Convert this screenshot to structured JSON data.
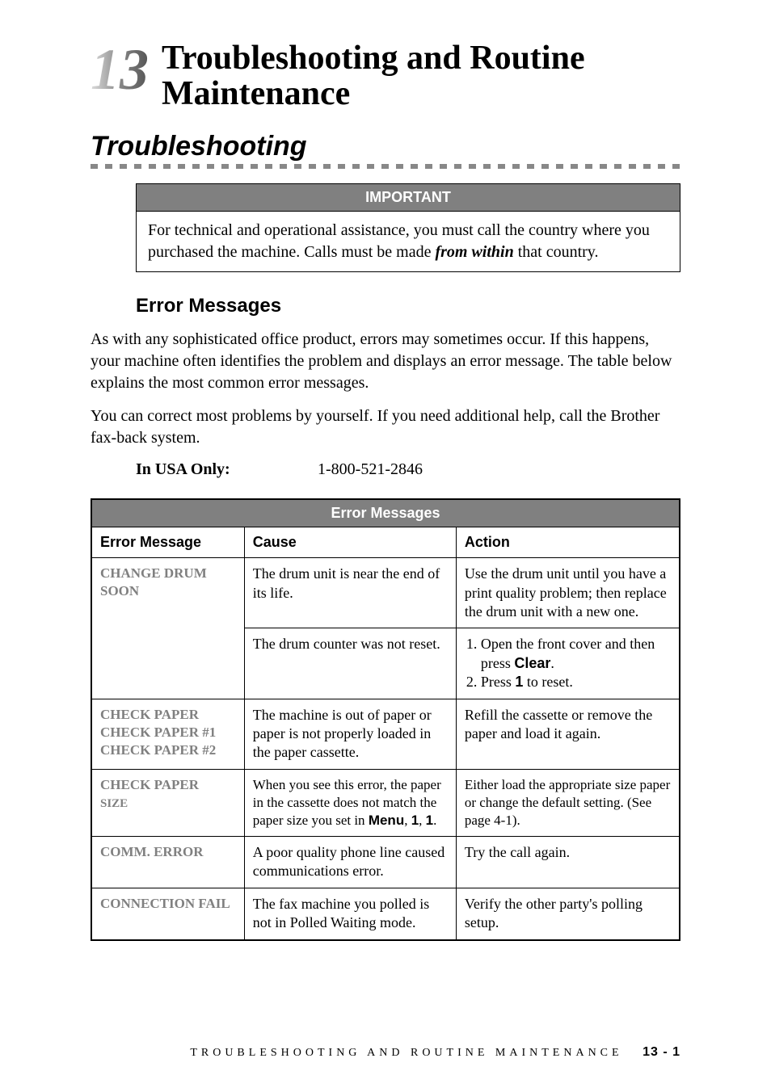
{
  "chapter": {
    "number": "13",
    "title": "Troubleshooting and Routine Maintenance"
  },
  "section": {
    "title": "Troubleshooting"
  },
  "important": {
    "header": "IMPORTANT",
    "text_before": "For technical and operational assistance, you must call the country where you purchased the machine. Calls must be made ",
    "emph": "from within",
    "text_after": " that country."
  },
  "subsection": {
    "title": "Error Messages",
    "para1": "As with any sophisticated office product, errors may sometimes occur. If this happens, your machine often identifies the problem and displays an error message. The table below explains the most common error messages.",
    "para2": "You can correct most problems by yourself. If you need additional help, call the Brother fax-back system.",
    "phone_label": "In USA Only:",
    "phone_number": "1-800-521-2846"
  },
  "table": {
    "title": "Error Messages",
    "headers": {
      "message": "Error Message",
      "cause": "Cause",
      "action": "Action"
    },
    "rows": [
      {
        "message_l1": "CHANGE DRUM",
        "message_l2": "SOON",
        "cause1": "The drum unit is near the end of its life.",
        "action1": "Use the drum unit until you have a print quality problem; then replace the drum unit with a new one.",
        "cause2": "The drum counter was not reset.",
        "action2_step1_before": "Open the front cover and then press ",
        "action2_step1_bold": "Clear",
        "action2_step1_after": ".",
        "action2_step2_before": "Press ",
        "action2_step2_bold": "1",
        "action2_step2_after": " to reset."
      },
      {
        "message_l1": "CHECK PAPER",
        "message_l2": "CHECK PAPER #1",
        "message_l3": "CHECK PAPER #2",
        "cause": "The machine is out of paper or paper is not properly loaded in the paper cassette.",
        "action": "Refill the cassette or remove the paper and load it again."
      },
      {
        "message_l1": "CHECK PAPER",
        "message_l2": "SIZE",
        "cause_before": "When you see this error, the paper in the cassette does not match the paper size you set in ",
        "cause_bold": "Menu",
        "cause_mid1": ", ",
        "cause_bold2": "1",
        "cause_mid2": ", ",
        "cause_bold3": "1",
        "cause_after": ".",
        "action": "Either load the appropriate size paper or change the default setting. (See page 4-1)."
      },
      {
        "message_l1": "COMM. ERROR",
        "cause": "A poor quality phone line caused communications error.",
        "action": "Try the call again."
      },
      {
        "message_l1": "CONNECTION FAIL",
        "cause": "The fax machine you polled is not in Polled Waiting mode.",
        "action": "Verify the other party's polling setup."
      }
    ]
  },
  "footer": {
    "text": "TROUBLESHOOTING AND ROUTINE MAINTENANCE",
    "pagenum": "13 - 1"
  }
}
